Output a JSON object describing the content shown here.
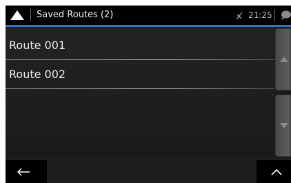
{
  "header": {
    "title": "Saved Routes (2)",
    "clock": "21:25",
    "icons": {
      "nav": "navigation-arrow-icon",
      "gps": "gps-off-icon",
      "messages": "chat-bubble-icon"
    },
    "accent_color": "#2f6fd8"
  },
  "routes": [
    {
      "label": "Route 001"
    },
    {
      "label": "Route 002"
    }
  ],
  "scroll": {
    "up_icon": "triangle-up-icon",
    "down_icon": "triangle-down-icon"
  },
  "footer": {
    "back_icon": "arrow-left-icon",
    "expand_icon": "chevron-up-icon"
  }
}
